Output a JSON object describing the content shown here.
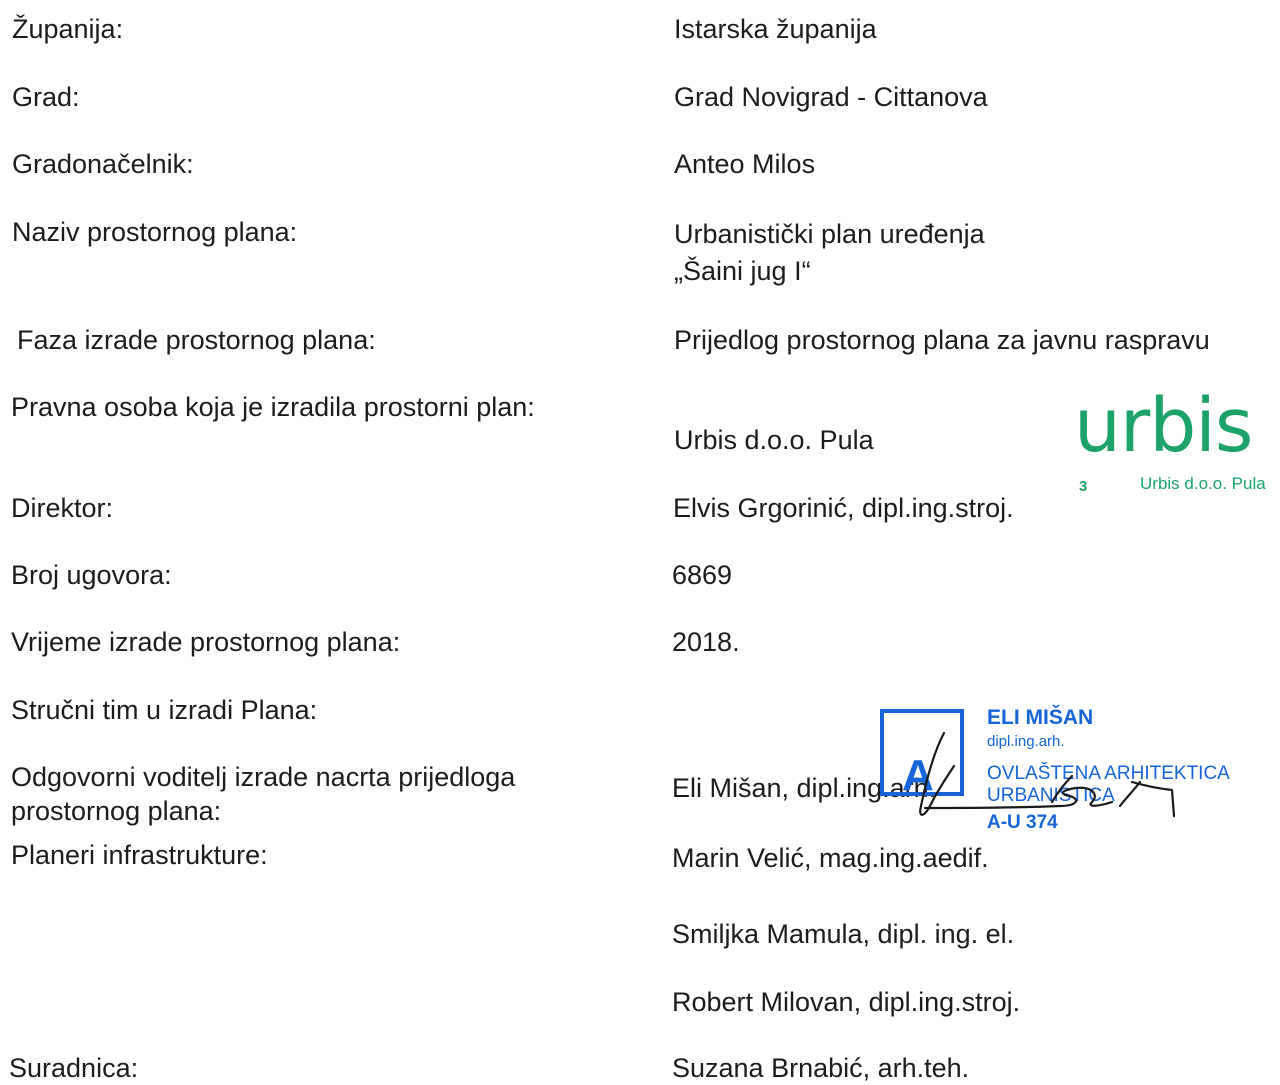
{
  "rows": [
    {
      "label": "Županija:",
      "value": "Istarska županija"
    },
    {
      "label": "Grad:",
      "value": "Grad Novigrad - Cittanova"
    },
    {
      "label": "Gradonačelnik:",
      "value": "Anteo Milos"
    },
    {
      "label": "Naziv prostornog plana:",
      "value": "Urbanistički plan uređenja",
      "value2": "„Šaini jug I“"
    },
    {
      "label": "Faza izrade prostornog plana:",
      "value": "Prijedlog prostornog plana za javnu raspravu"
    },
    {
      "label": "Pravna osoba koja je izradila prostorni plan:",
      "value": "Urbis  d.o.o. Pula"
    },
    {
      "label": "Direktor:",
      "value": "Elvis Grgorinić, dipl.ing.stroj."
    },
    {
      "label": "Broj ugovora:",
      "value": "6869"
    },
    {
      "label": "Vrijeme izrade prostornog plana:",
      "value": "2018."
    },
    {
      "label": "Stručni tim u izradi Plana:"
    },
    {
      "label": "Odgovorni voditelj izrade nacrta prijedloga",
      "label2": "prostornog plana:",
      "value": "Eli Mišan, dipl.ing.arh."
    },
    {
      "label": "Planeri infrastrukture:",
      "value": "Marin Velić, mag.ing.aedif."
    },
    {
      "value": "Smiljka Mamula, dipl. ing. el."
    },
    {
      "value": "Robert Milovan, dipl.ing.stroj."
    },
    {
      "label": "Suradnica:",
      "value": "Suzana Brnabić, arh.teh."
    }
  ],
  "logo": {
    "word": "urbis",
    "number": "3",
    "subtitle": "Urbis d.o.o. Pula",
    "color": "#1ba36a"
  },
  "stamp": {
    "letter": "A",
    "name": "ELI MIŠAN",
    "title": "dipl.ing.arh.",
    "line3": "OVLAŠTENA ARHITEKTICA",
    "line4": "URBANISTICA",
    "number": "A-U 374",
    "color": "#1565d8"
  }
}
